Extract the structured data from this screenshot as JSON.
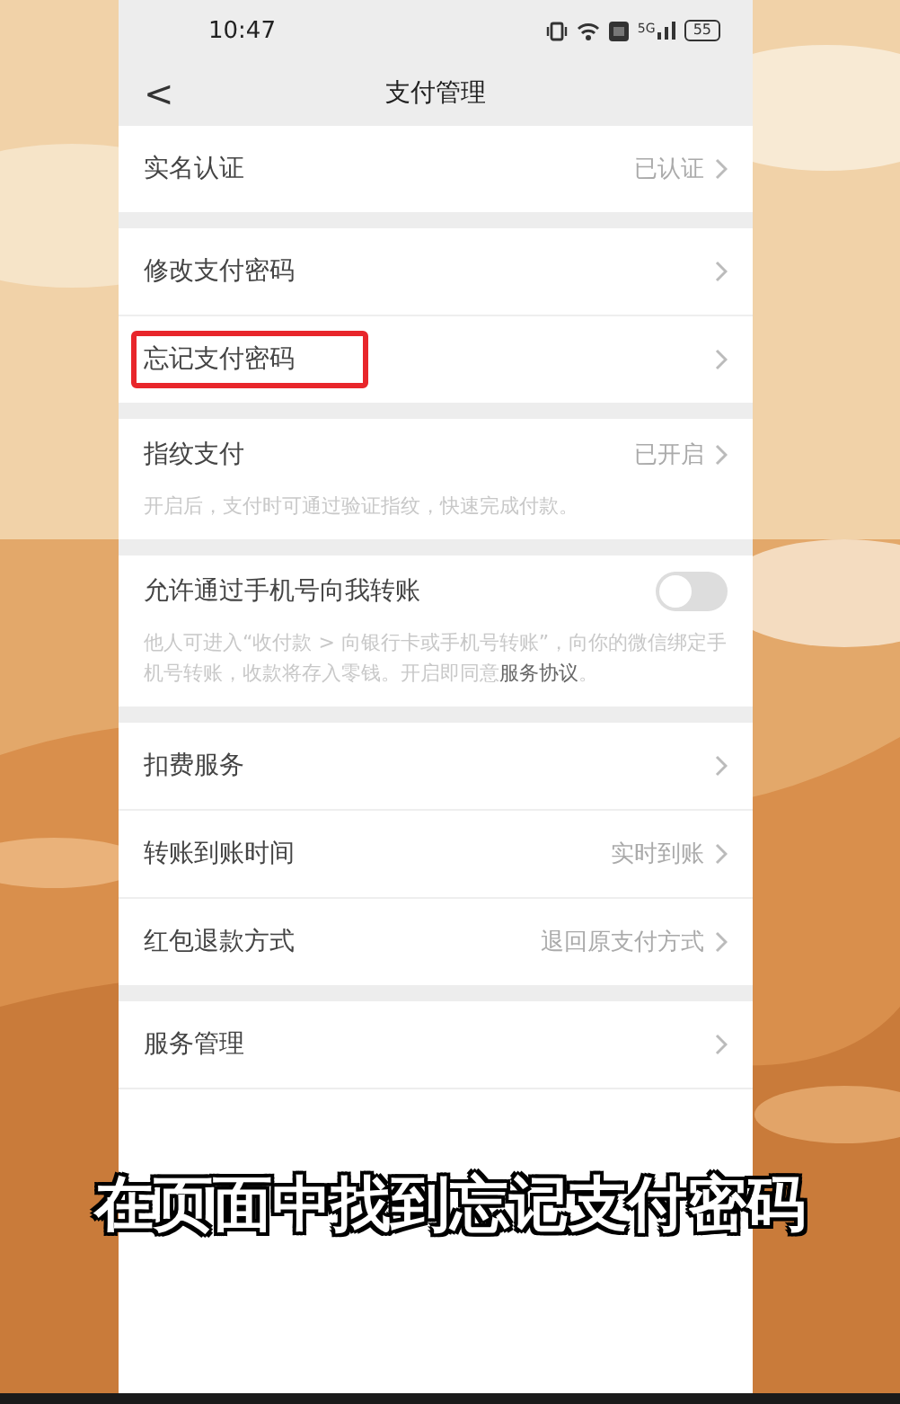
{
  "status_bar": {
    "time": "10:47",
    "network": "5G",
    "battery": "55"
  },
  "nav": {
    "back": "<",
    "title": "支付管理"
  },
  "sections": [
    {
      "rows": [
        {
          "kind": "link",
          "label": "实名认证",
          "value": "已认证",
          "highlighted": false
        }
      ]
    },
    {
      "rows": [
        {
          "kind": "link",
          "label": "修改支付密码",
          "highlighted": false
        },
        {
          "kind": "link",
          "label": "忘记支付密码",
          "highlighted": true
        }
      ]
    },
    {
      "rows": [
        {
          "kind": "link",
          "label": "指纹支付",
          "value": "已开启",
          "description": "开启后，支付时可通过验证指纹，快速完成付款。",
          "highlighted": false
        }
      ]
    },
    {
      "rows": [
        {
          "kind": "toggle",
          "label": "允许通过手机号向我转账",
          "on": false,
          "description": "他人可进入“收付款 > 向银行卡或手机号转账”，向你的微信绑定手机号转账，收款将存入零钱。开启即同意**服务协议**。",
          "highlighted": false
        }
      ]
    },
    {
      "rows": [
        {
          "kind": "link",
          "label": "扣费服务",
          "highlighted": false
        },
        {
          "kind": "link",
          "label": "转账到账时间",
          "value": "实时到账",
          "highlighted": false
        },
        {
          "kind": "link",
          "label": "红包退款方式",
          "value": "退回原支付方式",
          "highlighted": false
        }
      ]
    },
    {
      "rows": [
        {
          "kind": "link",
          "label": "服务管理",
          "highlighted": false
        }
      ]
    }
  ],
  "caption": "在页面中找到忘记支付密码"
}
